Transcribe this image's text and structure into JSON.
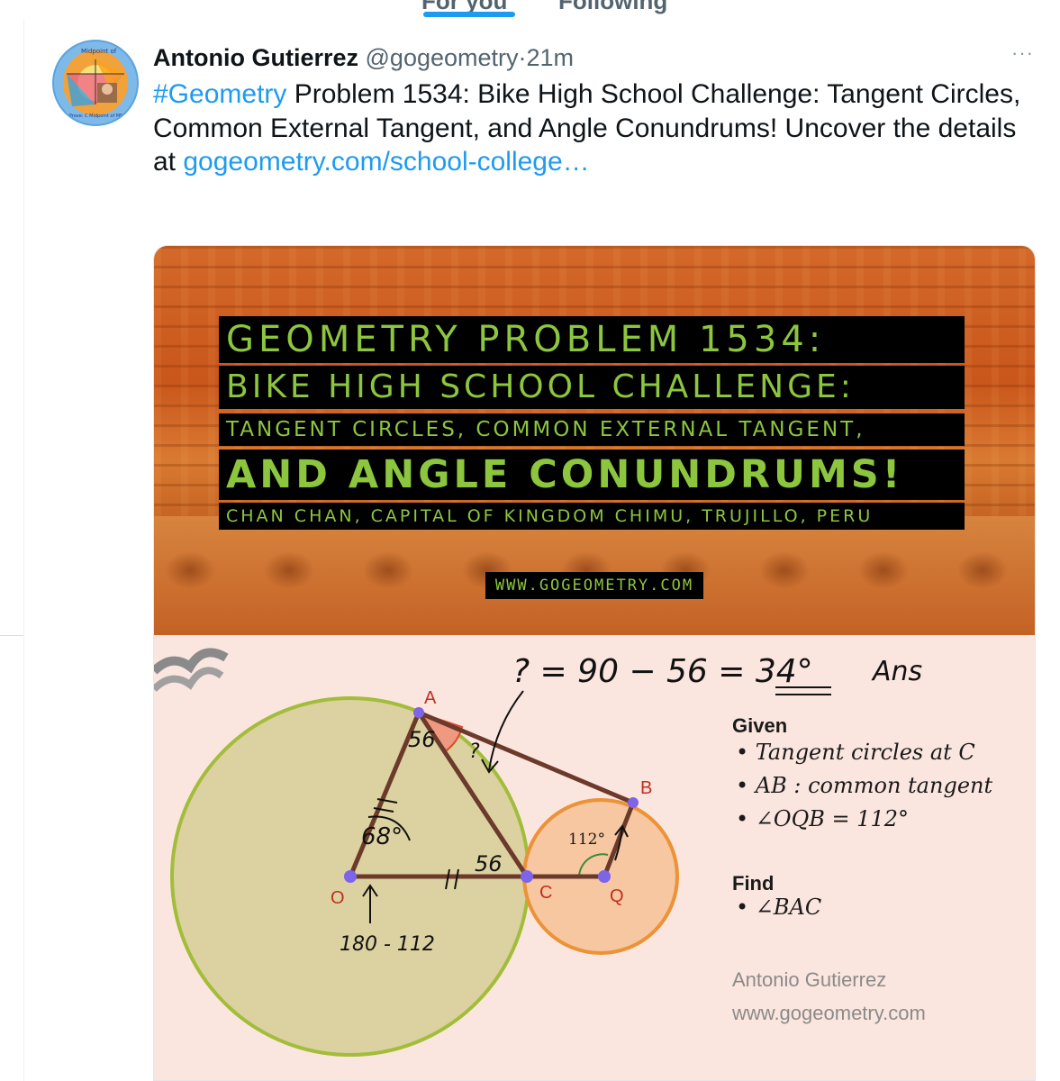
{
  "nav": {
    "tab_for_you": "For you",
    "tab_following": "Following"
  },
  "tweet": {
    "author_name": "Antonio Gutierrez",
    "handle": "@gogeometry",
    "separator": "·",
    "time": "21m",
    "more_icon": "···",
    "hashtag": "#Geometry",
    "text_main": " Problem 1534: Bike High School Challenge: Tangent Circles, Common External Tangent, and Angle Conundrums! Uncover the details at ",
    "link": "gogeometry.com/school-college…",
    "avatar_text": {
      "top": "Midpoint of",
      "bottom": "To Prove: C Midpoint of MN"
    }
  },
  "media": {
    "banner": {
      "line1": "GEOMETRY PROBLEM 1534:",
      "line2": "BIKE HIGH SCHOOL CHALLENGE:",
      "line3": "TANGENT CIRCLES, COMMON EXTERNAL TANGENT,",
      "line4": "AND ANGLE CONUNDRUMS!",
      "line5": "CHAN CHAN, CAPITAL OF KINGDOM CHIMU, TRUJILLO, PERU",
      "url": "WWW.GOGEOMETRY.COM"
    },
    "diagram": {
      "points": {
        "A": "A",
        "B": "B",
        "O": "O",
        "C": "C",
        "Q": "Q"
      },
      "angle_label": "112°",
      "handwriting": {
        "equation": "? = 90 − 56 = 34°",
        "ans": "Ans",
        "a56_top": "56",
        "a56_bottom": "56",
        "q_mark": "?",
        "a68": "68°",
        "below_o": "180 - 112"
      },
      "given_heading": "Given",
      "given_items": [
        "• Tangent circles at C",
        "• AB : common tangent",
        "• ∠OQB = 112°"
      ],
      "find_heading": "Find",
      "find_item": "• ∠BAC",
      "author": "Antonio Gutierrez",
      "website": "www.gogeometry.com"
    }
  },
  "colors": {
    "link_blue": "#1d9bf0",
    "banner_text_green": "#8cc63f",
    "big_circle_fill": "#dcd1a0",
    "big_circle_stroke": "#a2bd3a",
    "small_circle_fill": "#f6c7a0",
    "small_circle_stroke": "#ec9237",
    "point_purple": "#7d64e8"
  }
}
